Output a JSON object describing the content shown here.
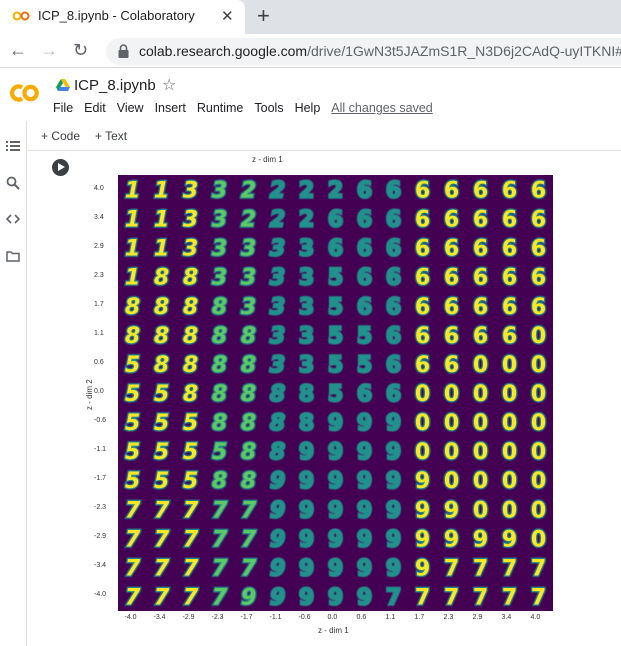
{
  "browser": {
    "tab_title": "ICP_8.ipynb - Colaboratory",
    "close_glyph": "✕",
    "new_tab_glyph": "+",
    "back_glyph": "←",
    "forward_glyph": "→",
    "reload_glyph": "↻",
    "url_host": "colab.research.google.com",
    "url_path": "/drive/1GwN3t5JAZmS1R_N3D6j2CAdQ-uyITKNI#sc"
  },
  "colab": {
    "title": "ICP_8.ipynb",
    "star_glyph": "☆",
    "menu": [
      "File",
      "Edit",
      "View",
      "Insert",
      "Runtime",
      "Tools",
      "Help"
    ],
    "saved_status": "All changes saved",
    "add_code": "+ Code",
    "add_text": "+ Text",
    "accent": "#f9ab00"
  },
  "rail_icons": [
    "toc-icon",
    "search-icon",
    "code-icon",
    "folder-icon"
  ],
  "chart_data": {
    "type": "heatmap",
    "description_grid": "15 x 15 grid of decoded MNIST digits from VAE latent space",
    "top_label": "z - dim 1",
    "xlabel": "z - dim 1",
    "ylabel": "z - dim 2",
    "x_ticks": [
      "-4.0",
      "-3.4",
      "-2.9",
      "-2.3",
      "-1.7",
      "-1.1",
      "-0.6",
      "0.0",
      "0.6",
      "1.1",
      "1.7",
      "2.3",
      "2.9",
      "3.4",
      "4.0"
    ],
    "y_ticks": [
      "4.0",
      "3.4",
      "2.9",
      "2.3",
      "1.7",
      "1.1",
      "0.6",
      "0.0",
      "-0.6",
      "-1.1",
      "-1.7",
      "-2.3",
      "-2.9",
      "-3.4",
      "-4.0"
    ],
    "digits": [
      "113322226666666",
      "113322266666666",
      "113333366666666",
      "188333356666666",
      "888833356666666",
      "888883355666660",
      "588883355666000",
      "558888856600000",
      "555888899900000",
      "555588999900000",
      "555889999990000",
      "777779999999000",
      "777779999999990",
      "777779999997777",
      "777799999777777"
    ],
    "colormap": [
      "#440154",
      "#3b528b",
      "#21918c",
      "#5ec962",
      "#fde725"
    ]
  }
}
